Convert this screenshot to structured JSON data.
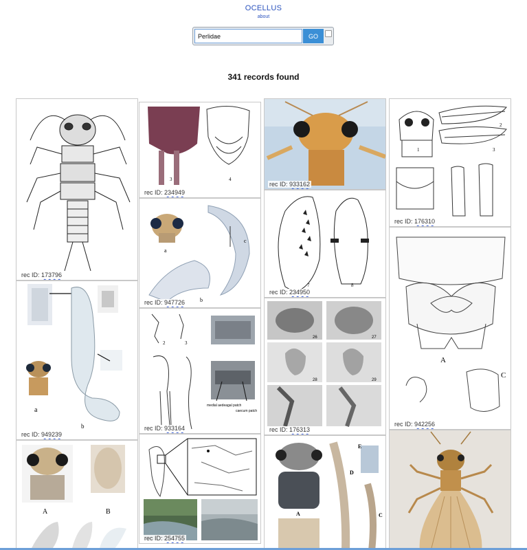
{
  "app": {
    "title": "OCELLUS",
    "about_label": "about"
  },
  "search": {
    "value": "Perlidae",
    "go_label": "GO"
  },
  "results": {
    "count_text": "341 records found"
  },
  "records": [
    {
      "prefix": "rec ID: ",
      "id": "173796"
    },
    {
      "prefix": "rec ID: ",
      "id": "949239"
    },
    {
      "prefix": "rec ID: ",
      "id": "234949"
    },
    {
      "prefix": "rec ID: ",
      "id": "947726"
    },
    {
      "prefix": "rec ID: ",
      "id": "933164"
    },
    {
      "prefix": "rec ID: ",
      "id": "254755"
    },
    {
      "prefix": "rec ID: ",
      "id": "933162"
    },
    {
      "prefix": "rec ID: ",
      "id": "234950"
    },
    {
      "prefix": "rec ID: ",
      "id": "176313"
    },
    {
      "prefix": "rec ID: ",
      "id": "176310"
    },
    {
      "prefix": "rec ID: ",
      "id": "942256"
    }
  ],
  "figure_labels": {
    "fig_234949": [
      "3",
      "4"
    ],
    "fig_947726": [
      "a",
      "c",
      "b"
    ],
    "fig_933164": [
      "2",
      "3",
      "medial aedeagal patch",
      "caecum patch"
    ],
    "fig_234950": [
      "7",
      "8"
    ],
    "fig_176313": [
      "26",
      "27",
      "28",
      "29"
    ],
    "fig_176310": [
      "1",
      "2",
      "3"
    ],
    "fig_942256": [
      "A",
      "C"
    ],
    "fig_949239": [
      "a",
      "b"
    ],
    "fig_last_col1": [
      "A",
      "B"
    ],
    "fig_last_col3": [
      "A",
      "D",
      "E",
      "C"
    ]
  },
  "colors": {
    "link": "#2a52be",
    "go_button": "#3b8fd6",
    "wavy_underline": "#3a5fd9"
  }
}
